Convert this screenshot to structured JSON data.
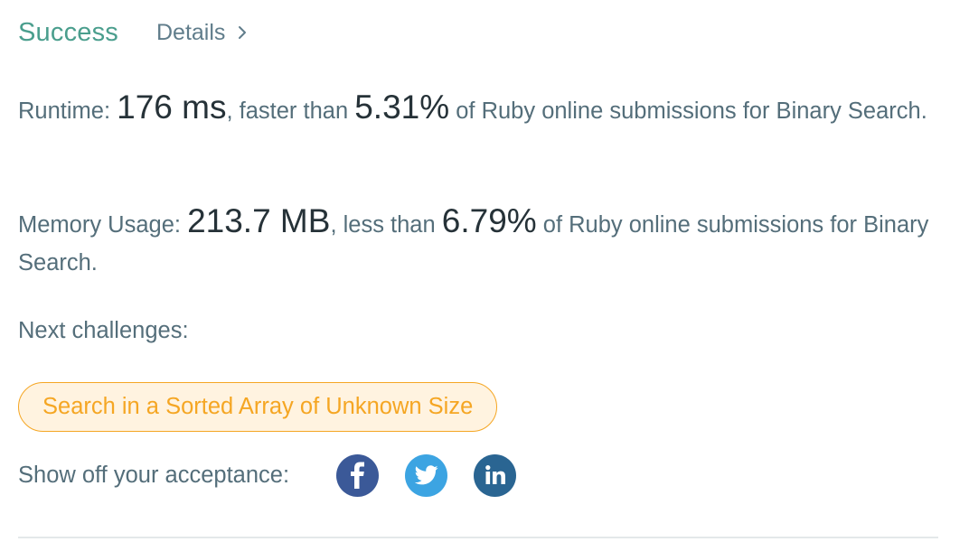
{
  "header": {
    "status": "Success",
    "details_label": "Details"
  },
  "runtime": {
    "label": "Runtime: ",
    "value": "176 ms",
    "mid": ", faster than ",
    "percent": "5.31%",
    "tail": " of Ruby online submissions for Binary Search."
  },
  "memory": {
    "label": "Memory Usage: ",
    "value": "213.7 MB",
    "mid": ", less than ",
    "percent": "6.79%",
    "tail": " of Ruby online submissions for Binary Search."
  },
  "next": {
    "title": "Next challenges:",
    "challenges": [
      {
        "label": "Search in a Sorted Array of Unknown Size"
      }
    ]
  },
  "share": {
    "label": "Show off your acceptance:",
    "icons": [
      {
        "name": "facebook-icon",
        "color": "#3b5998"
      },
      {
        "name": "twitter-icon",
        "color": "#3ca4e2"
      },
      {
        "name": "linkedin-icon",
        "color": "#2a6592"
      }
    ]
  },
  "colors": {
    "success": "#4a9e8d",
    "challenge_text": "#f5a623",
    "challenge_bg": "#fff3e0"
  }
}
